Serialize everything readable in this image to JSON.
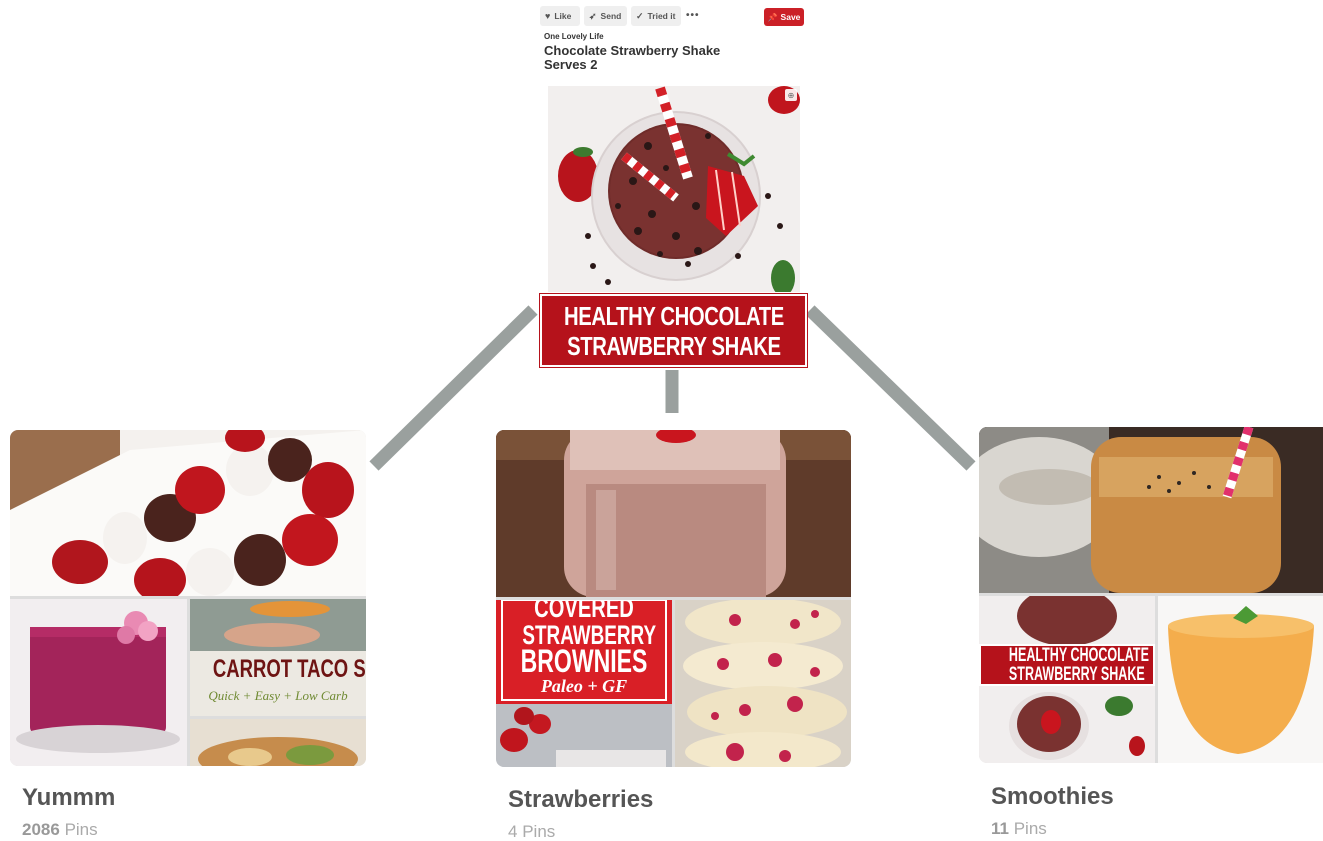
{
  "pin": {
    "actions": {
      "like": "Like",
      "send": "Send",
      "tried": "Tried it",
      "more": "•••",
      "save": "Save"
    },
    "source": "One Lovely Life",
    "title_line1": "Chocolate Strawberry Shake",
    "title_line2": "Serves 2",
    "banner_line1": "HEALTHY CHOCOLATE",
    "banner_line2": "STRAWBERRY SHAKE"
  },
  "boards": [
    {
      "name": "Yummm",
      "count": "2086",
      "count_label": "Pins",
      "tile_text_main": "CARROT TACO SHELL",
      "tile_text_sub": "Quick + Easy + Low Carb"
    },
    {
      "name": "Strawberries",
      "count": "4",
      "count_label": "Pins",
      "tile_text_1": "COVERED",
      "tile_text_2": "STRAWBERRY",
      "tile_text_3": "BROWNIES",
      "tile_text_4": "Paleo + GF"
    },
    {
      "name": "Smoothies",
      "count": "11",
      "count_label": "Pins",
      "tile_text_1": "HEALTHY CHOCOLATE",
      "tile_text_2": "STRAWBERRY SHAKE"
    }
  ],
  "colors": {
    "save_red": "#cb2027",
    "banner_red": "#b5121b",
    "connector_gray": "#9aa09e"
  },
  "icons": [
    "heart-icon",
    "send-icon",
    "check-icon",
    "more-icon",
    "pin-icon",
    "zoom-icon"
  ]
}
